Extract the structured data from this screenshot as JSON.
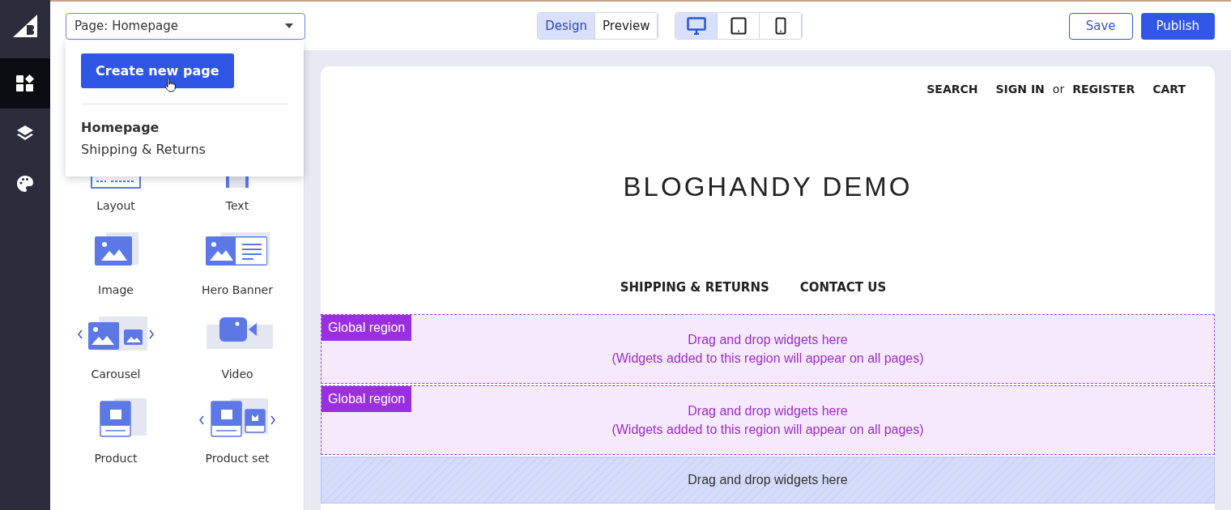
{
  "rail": [
    {
      "kind": "widgets",
      "selected": true
    },
    {
      "kind": "layers",
      "selected": false
    },
    {
      "kind": "theme",
      "selected": false
    }
  ],
  "page_select": {
    "value": "Page: Homepage",
    "expanded": true
  },
  "page_menu": {
    "button": "Create new page",
    "pages": [
      {
        "label": "Homepage",
        "selected": true
      },
      {
        "label": "Shipping & Returns",
        "selected": false
      }
    ]
  },
  "mode_tabs": [
    {
      "label": "Design",
      "selected": true
    },
    {
      "label": "Preview",
      "selected": false
    }
  ],
  "devices": [
    {
      "kind": "desktop",
      "selected": true
    },
    {
      "kind": "tablet",
      "selected": false
    },
    {
      "kind": "mobile",
      "selected": false
    }
  ],
  "actions": {
    "save": "Save",
    "publish": "Publish"
  },
  "widgets": [
    {
      "kind": "layout",
      "label": "Layout"
    },
    {
      "kind": "text",
      "label": "Text"
    },
    {
      "kind": "image",
      "label": "Image"
    },
    {
      "kind": "hero",
      "label": "Hero Banner"
    },
    {
      "kind": "carousel",
      "label": "Carousel"
    },
    {
      "kind": "video",
      "label": "Video"
    },
    {
      "kind": "product",
      "label": "Product"
    },
    {
      "kind": "productset",
      "label": "Product set"
    }
  ],
  "store": {
    "header_links": [
      "SEARCH",
      "SIGN IN",
      "or",
      "REGISTER",
      "CART"
    ],
    "title": "BLOGHANDY DEMO",
    "nav": [
      "SHIPPING & RETURNS",
      "CONTACT US"
    ]
  },
  "regions": [
    {
      "kind": "global",
      "tag": "Global region",
      "lines": [
        "Drag and drop widgets here",
        "(Widgets added to this region will appear on all pages)"
      ]
    },
    {
      "kind": "global",
      "tag": "Global region",
      "lines": [
        "Drag and drop widgets here",
        "(Widgets added to this region will appear on all pages)"
      ]
    },
    {
      "kind": "drop",
      "lines": [
        "Drag and drop widgets here"
      ]
    }
  ]
}
